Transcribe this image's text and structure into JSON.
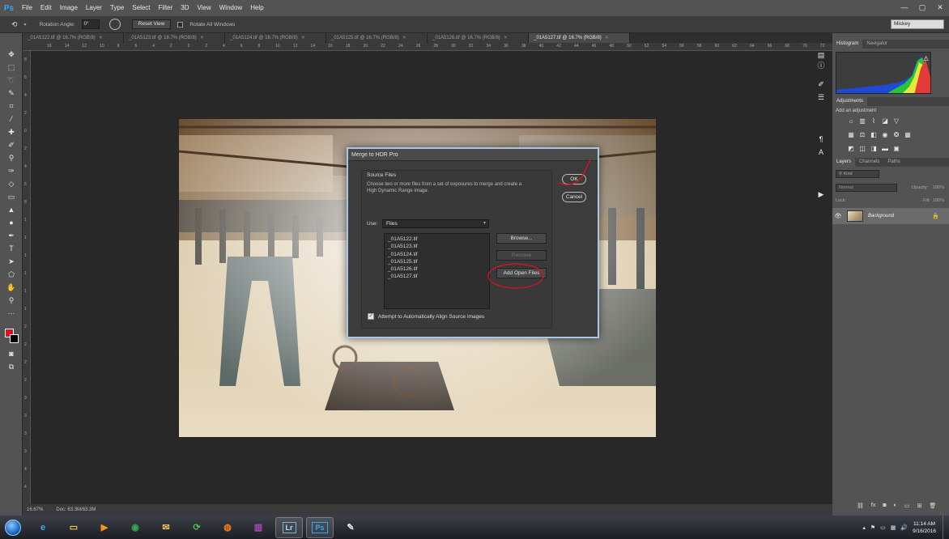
{
  "app": {
    "logo": "Ps",
    "menu": [
      "File",
      "Edit",
      "Image",
      "Layer",
      "Type",
      "Select",
      "Filter",
      "3D",
      "View",
      "Window",
      "Help"
    ],
    "window_controls": [
      "—",
      "▢",
      "✕"
    ]
  },
  "options_bar": {
    "rotation_label": "Rotation Angle:",
    "rotation_value": "0°",
    "reset_view_label": "Reset View",
    "rotate_all_label": "Rotate All Windows",
    "workspace": "Mickey"
  },
  "doc_tabs": [
    {
      "label": "_01A5122.tif @ 16.7% (RGB/8)",
      "active": false
    },
    {
      "label": "_01A5123.tif @ 16.7% (RGB/8)",
      "active": false
    },
    {
      "label": "_01A5124.tif @ 16.7% (RGB/8)",
      "active": false
    },
    {
      "label": "_01A5125.tif @ 16.7% (RGB/8)",
      "active": false
    },
    {
      "label": "_01A5126.tif @ 16.7% (RGB/8)",
      "active": false
    },
    {
      "label": "_01A5127.tif @ 16.7% (RGB/8)",
      "active": true
    }
  ],
  "ruler_top": [
    "16",
    "14",
    "12",
    "10",
    "8",
    "6",
    "4",
    "2",
    "0",
    "2",
    "4",
    "6",
    "8",
    "10",
    "12",
    "14",
    "16",
    "18",
    "20",
    "22",
    "24",
    "26",
    "28",
    "30",
    "32",
    "34",
    "36",
    "38",
    "40",
    "42",
    "44",
    "46",
    "48",
    "50",
    "52",
    "54",
    "56",
    "58",
    "60",
    "62",
    "64",
    "66",
    "68",
    "70",
    "72",
    "74"
  ],
  "ruler_left": [
    "8",
    "6",
    "4",
    "2",
    "0",
    "2",
    "4",
    "6",
    "8",
    "1",
    "1",
    "1",
    "1",
    "1",
    "1",
    "2",
    "2",
    "2",
    "2",
    "3",
    "3",
    "3",
    "3",
    "4",
    "4"
  ],
  "status": {
    "zoom": "16.67%",
    "doc": "Doc: 63.3M/63.3M"
  },
  "dialog": {
    "title": "Merge to HDR Pro",
    "group_title": "Source Files",
    "description": "Choose two or more files from a set of exposures to merge and create a High Dynamic Range image.",
    "use_label": "Use:",
    "use_value": "Files",
    "files": [
      "_01A5122.tif",
      "_01A5123.tif",
      "_01A5124.tif",
      "_01A5125.tif",
      "_01A5126.tif",
      "_01A5127.tif"
    ],
    "browse_label": "Browse...",
    "remove_label": "Remove",
    "add_open_label": "Add Open Files",
    "ok_label": "OK",
    "cancel_label": "Cancel",
    "align_label": "Attempt to Automatically Align Source Images",
    "align_checked": true
  },
  "panels": {
    "histogram_tabs": [
      "Histogram",
      "Navigator"
    ],
    "adjustments_title": "Adjustments",
    "add_adjustment": "Add an adjustment",
    "layers_tabs": [
      "Layers",
      "Channels",
      "Paths"
    ],
    "kind_filter": "Kind",
    "blend_mode": "Normal",
    "opacity_label": "Opacity:",
    "opacity_value": "100%",
    "lock_label": "Lock:",
    "fill_label": "Fill:",
    "fill_value": "100%",
    "layer_name": "Background"
  },
  "colors": {
    "foreground": "#e3101f",
    "background": "#000000",
    "annotation": "#e0101f"
  },
  "taskbar": {
    "icons": [
      "ie-icon",
      "folder-icon",
      "media-player-icon",
      "chrome-icon",
      "briefcase-icon",
      "sync-icon",
      "firefox-icon",
      "winrar-icon",
      "lightroom-icon",
      "photoshop-icon",
      "paint-icon"
    ],
    "lr_label": "Lr",
    "ps_label": "Ps",
    "time": "11:14 AM",
    "date": "9/16/2016"
  }
}
